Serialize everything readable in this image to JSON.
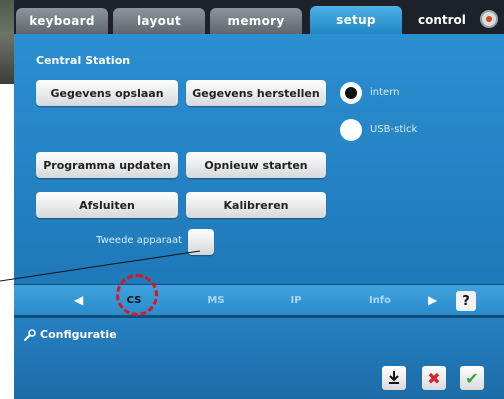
{
  "tabs": [
    {
      "label": "keyboard",
      "active": false
    },
    {
      "label": "layout",
      "active": false
    },
    {
      "label": "memory",
      "active": false
    },
    {
      "label": "setup",
      "active": true
    }
  ],
  "control_label": "control",
  "panel": {
    "title": "Central Station",
    "buttons": {
      "save": "Gegevens opslaan",
      "restore": "Gegevens herstellen",
      "update": "Programma updaten",
      "restart": "Opnieuw starten",
      "close": "Afsluiten",
      "calibrate": "Kalibreren"
    },
    "radio": {
      "intern": "intern",
      "usb": "USB-stick",
      "selected": "intern"
    },
    "checkbox_label": "Tweede apparaat"
  },
  "subtabs": [
    {
      "label": "CS",
      "active": true
    },
    {
      "label": "MS",
      "active": false
    },
    {
      "label": "IP",
      "active": false
    },
    {
      "label": "Info",
      "active": false
    }
  ],
  "help_label": "?",
  "configuratie": {
    "title": "Configuratie"
  },
  "colors": {
    "panel_blue": "#2b8fd0",
    "highlight_red": "#e0141c",
    "confirm_green": "#2fa83a",
    "cancel_red": "#d8262b"
  }
}
